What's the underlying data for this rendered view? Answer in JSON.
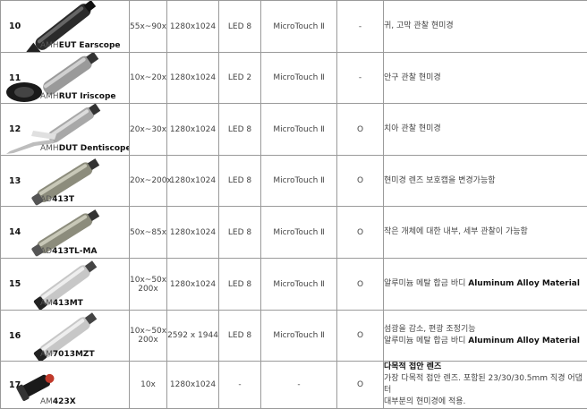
{
  "rows": [
    {
      "num": "10",
      "prefix": "AMH",
      "bold": "EUT Earscope",
      "zoom": [
        "55x~90x"
      ],
      "res": "1280x1024",
      "led": "LED 8",
      "touch": "MicroTouch Ⅱ",
      "opt": "-",
      "desc_title": "",
      "desc": [
        "귀, 고막 관찰 현미경"
      ],
      "desc_bold_suffix": "",
      "icon": "earscope-icon"
    },
    {
      "num": "11",
      "prefix": "AMH",
      "bold": "RUT Iriscope",
      "zoom": [
        "10x~20x"
      ],
      "res": "1280x1024",
      "led": "LED 2",
      "touch": "MicroTouch Ⅱ",
      "opt": "-",
      "desc_title": "",
      "desc": [
        "안구 관찰 현미경"
      ],
      "desc_bold_suffix": "",
      "icon": "iriscope-icon"
    },
    {
      "num": "12",
      "prefix": "AMH",
      "bold": "DUT Dentiscope",
      "zoom": [
        "20x~30x"
      ],
      "res": "1280x1024",
      "led": "LED 8",
      "touch": "MicroTouch Ⅱ",
      "opt": "O",
      "desc_title": "",
      "desc": [
        "치아 관찰 현미경"
      ],
      "desc_bold_suffix": "",
      "icon": "dentiscope-icon"
    },
    {
      "num": "13",
      "prefix": "AD",
      "bold": "413T",
      "zoom": [
        "20x~200x"
      ],
      "res": "1280x1024",
      "led": "LED 8",
      "touch": "MicroTouch Ⅱ",
      "opt": "O",
      "desc_title": "",
      "desc": [
        "현미경 렌즈 보호캡을 변경가능함"
      ],
      "desc_bold_suffix": "",
      "icon": "microscope-icon"
    },
    {
      "num": "14",
      "prefix": "AD",
      "bold": "413TL-MA",
      "zoom": [
        "50x~85x"
      ],
      "res": "1280x1024",
      "led": "LED 8",
      "touch": "MicroTouch Ⅱ",
      "opt": "O",
      "desc_title": "",
      "desc": [
        "작은 개체에 대한 내부, 세부 관찰이 가능함"
      ],
      "desc_bold_suffix": "",
      "icon": "microscope-icon"
    },
    {
      "num": "15",
      "prefix": "AM",
      "bold": "413MT",
      "zoom": [
        "10x~50x",
        "200x"
      ],
      "res": "1280x1024",
      "led": "LED 8",
      "touch": "MicroTouch Ⅱ",
      "opt": "O",
      "desc_title": "",
      "desc": [
        "알루미늄 메탈 합금 바디 "
      ],
      "desc_bold_suffix": "Aluminum Alloy Material",
      "icon": "metal-microscope-icon"
    },
    {
      "num": "16",
      "prefix": "AM",
      "bold": "7013MZT",
      "zoom": [
        "10x~50x",
        "200x"
      ],
      "res": "2592 x 1944",
      "led": "LED 8",
      "touch": "MicroTouch Ⅱ",
      "opt": "O",
      "desc_title": "",
      "desc": [
        "섬광을 감소, 편광 조정기능",
        "알루미늄 메탈 합금 바디 "
      ],
      "desc_bold_suffix": "Aluminum Alloy Material",
      "icon": "metal-microscope-icon"
    },
    {
      "num": "17",
      "prefix": "AM",
      "bold": "423X",
      "zoom": [
        "10x"
      ],
      "res": "1280x1024",
      "led": "-",
      "touch": "-",
      "opt": "O",
      "desc_title": "다목적 접안 렌즈",
      "desc": [
        "가장 다목적 접안 렌즈. 포함된 23/30/30.5mm 직경 어댑터",
        "대부분의 현미경에 적용."
      ],
      "desc_bold_suffix": "",
      "icon": "eyepiece-icon"
    }
  ]
}
